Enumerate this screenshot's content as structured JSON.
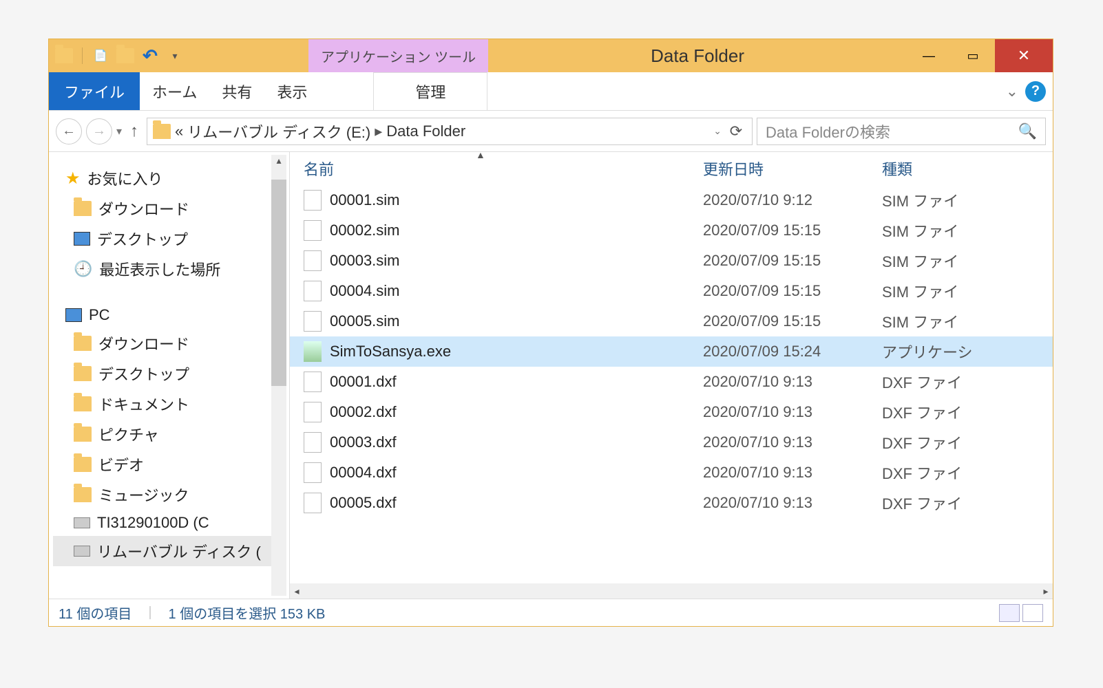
{
  "titlebar": {
    "context_tab": "アプリケーション ツール",
    "title": "Data Folder"
  },
  "ribbon": {
    "file": "ファイル",
    "tabs": [
      "ホーム",
      "共有",
      "表示"
    ],
    "context": "管理"
  },
  "nav": {
    "back": "←",
    "forward": "→",
    "up": "↑"
  },
  "address": {
    "prefix": "«",
    "crumb1": "リムーバブル ディスク (E:)",
    "crumb2": "Data Folder"
  },
  "search": {
    "placeholder": "Data Folderの検索"
  },
  "tree": {
    "favorites": "お気に入り",
    "downloads": "ダウンロード",
    "desktop": "デスクトップ",
    "recent": "最近表示した場所",
    "pc": "PC",
    "pc_downloads": "ダウンロード",
    "pc_desktop": "デスクトップ",
    "pc_documents": "ドキュメント",
    "pc_pictures": "ピクチャ",
    "pc_videos": "ビデオ",
    "pc_music": "ミュージック",
    "pc_cdrive": "TI31290100D (C",
    "pc_removable": "リムーバブル ディスク ("
  },
  "columns": {
    "name": "名前",
    "date": "更新日時",
    "type": "種類"
  },
  "files": [
    {
      "name": "00001.sim",
      "date": "2020/07/10 9:12",
      "type": "SIM ファイ",
      "icon": "file",
      "sel": false
    },
    {
      "name": "00002.sim",
      "date": "2020/07/09 15:15",
      "type": "SIM ファイ",
      "icon": "file",
      "sel": false
    },
    {
      "name": "00003.sim",
      "date": "2020/07/09 15:15",
      "type": "SIM ファイ",
      "icon": "file",
      "sel": false
    },
    {
      "name": "00004.sim",
      "date": "2020/07/09 15:15",
      "type": "SIM ファイ",
      "icon": "file",
      "sel": false
    },
    {
      "name": "00005.sim",
      "date": "2020/07/09 15:15",
      "type": "SIM ファイ",
      "icon": "file",
      "sel": false
    },
    {
      "name": "SimToSansya.exe",
      "date": "2020/07/09 15:24",
      "type": "アプリケーシ",
      "icon": "exe",
      "sel": true
    },
    {
      "name": "00001.dxf",
      "date": "2020/07/10 9:13",
      "type": "DXF ファイ",
      "icon": "file",
      "sel": false
    },
    {
      "name": "00002.dxf",
      "date": "2020/07/10 9:13",
      "type": "DXF ファイ",
      "icon": "file",
      "sel": false
    },
    {
      "name": "00003.dxf",
      "date": "2020/07/10 9:13",
      "type": "DXF ファイ",
      "icon": "file",
      "sel": false
    },
    {
      "name": "00004.dxf",
      "date": "2020/07/10 9:13",
      "type": "DXF ファイ",
      "icon": "file",
      "sel": false
    },
    {
      "name": "00005.dxf",
      "date": "2020/07/10 9:13",
      "type": "DXF ファイ",
      "icon": "file",
      "sel": false
    }
  ],
  "status": {
    "count": "11 個の項目",
    "selection": "1 個の項目を選択 153 KB"
  }
}
